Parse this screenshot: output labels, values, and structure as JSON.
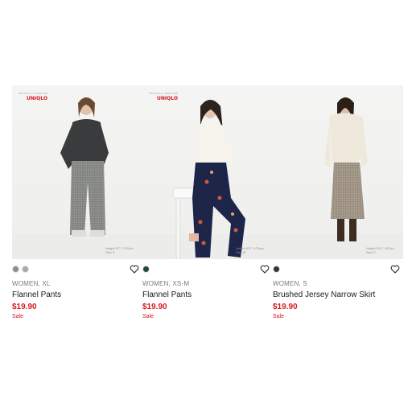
{
  "products": [
    {
      "brand_line": "SPECIALLY CRAFTED",
      "logo": "UNIQLO",
      "model_height": "Height 5'7\" / 170cm",
      "model_size": "Size S",
      "swatches": [
        "#8d8d8b",
        "#a9aaa7"
      ],
      "size_label": "WOMEN, XL",
      "name": "Flannel Pants",
      "price": "$19.90",
      "tag": "Sale"
    },
    {
      "brand_line": "SPECIALLY CRAFTED",
      "logo": "UNIQLO",
      "model_height": "Height 5'9\" / 175cm",
      "model_size": "Size M",
      "swatches": [
        "#1f4c3a"
      ],
      "size_label": "WOMEN, XS-M",
      "name": "Flannel Pants",
      "price": "$19.90",
      "tag": "Sale"
    },
    {
      "brand_line": "",
      "logo": "",
      "model_height": "Height 5'6\" / 167cm",
      "model_size": "Size S",
      "swatches": [
        "#2f3a2b"
      ],
      "size_label": "WOMEN, S",
      "name": "Brushed Jersey Narrow Skirt",
      "price": "$19.90",
      "tag": "Sale"
    }
  ],
  "icons": {
    "favorite": "heart-outline-icon"
  },
  "colors": {
    "price": "#d7191f",
    "text": "#1b1b1b",
    "muted": "#7a7a7a"
  }
}
